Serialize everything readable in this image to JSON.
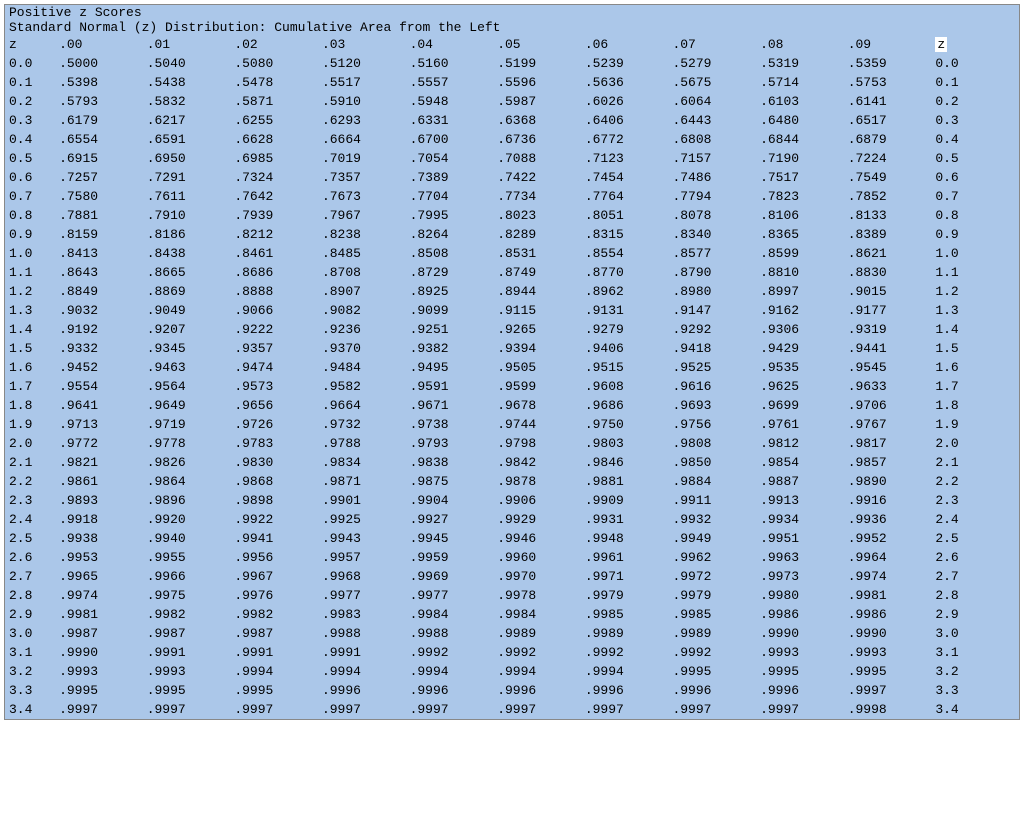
{
  "title": "Positive z Scores",
  "subtitle": "Standard Normal (z) Distribution: Cumulative Area from the Left",
  "header_z": "z",
  "col_headers": [
    ".00",
    ".01",
    ".02",
    ".03",
    ".04",
    ".05",
    ".06",
    ".07",
    ".08",
    ".09"
  ],
  "chart_data": {
    "type": "table",
    "title": "Standard Normal (z) Distribution: Cumulative Area from the Left",
    "categories": [
      "0.0",
      "0.1",
      "0.2",
      "0.3",
      "0.4",
      "0.5",
      "0.6",
      "0.7",
      "0.8",
      "0.9",
      "1.0",
      "1.1",
      "1.2",
      "1.3",
      "1.4",
      "1.5",
      "1.6",
      "1.7",
      "1.8",
      "1.9",
      "2.0",
      "2.1",
      "2.2",
      "2.3",
      "2.4",
      "2.5",
      "2.6",
      "2.7",
      "2.8",
      "2.9",
      "3.0",
      "3.1",
      "3.2",
      "3.3",
      "3.4"
    ],
    "col_labels": [
      ".00",
      ".01",
      ".02",
      ".03",
      ".04",
      ".05",
      ".06",
      ".07",
      ".08",
      ".09"
    ],
    "rows": [
      [
        ".5000",
        ".5040",
        ".5080",
        ".5120",
        ".5160",
        ".5199",
        ".5239",
        ".5279",
        ".5319",
        ".5359"
      ],
      [
        ".5398",
        ".5438",
        ".5478",
        ".5517",
        ".5557",
        ".5596",
        ".5636",
        ".5675",
        ".5714",
        ".5753"
      ],
      [
        ".5793",
        ".5832",
        ".5871",
        ".5910",
        ".5948",
        ".5987",
        ".6026",
        ".6064",
        ".6103",
        ".6141"
      ],
      [
        ".6179",
        ".6217",
        ".6255",
        ".6293",
        ".6331",
        ".6368",
        ".6406",
        ".6443",
        ".6480",
        ".6517"
      ],
      [
        ".6554",
        ".6591",
        ".6628",
        ".6664",
        ".6700",
        ".6736",
        ".6772",
        ".6808",
        ".6844",
        ".6879"
      ],
      [
        ".6915",
        ".6950",
        ".6985",
        ".7019",
        ".7054",
        ".7088",
        ".7123",
        ".7157",
        ".7190",
        ".7224"
      ],
      [
        ".7257",
        ".7291",
        ".7324",
        ".7357",
        ".7389",
        ".7422",
        ".7454",
        ".7486",
        ".7517",
        ".7549"
      ],
      [
        ".7580",
        ".7611",
        ".7642",
        ".7673",
        ".7704",
        ".7734",
        ".7764",
        ".7794",
        ".7823",
        ".7852"
      ],
      [
        ".7881",
        ".7910",
        ".7939",
        ".7967",
        ".7995",
        ".8023",
        ".8051",
        ".8078",
        ".8106",
        ".8133"
      ],
      [
        ".8159",
        ".8186",
        ".8212",
        ".8238",
        ".8264",
        ".8289",
        ".8315",
        ".8340",
        ".8365",
        ".8389"
      ],
      [
        ".8413",
        ".8438",
        ".8461",
        ".8485",
        ".8508",
        ".8531",
        ".8554",
        ".8577",
        ".8599",
        ".8621"
      ],
      [
        ".8643",
        ".8665",
        ".8686",
        ".8708",
        ".8729",
        ".8749",
        ".8770",
        ".8790",
        ".8810",
        ".8830"
      ],
      [
        ".8849",
        ".8869",
        ".8888",
        ".8907",
        ".8925",
        ".8944",
        ".8962",
        ".8980",
        ".8997",
        ".9015"
      ],
      [
        ".9032",
        ".9049",
        ".9066",
        ".9082",
        ".9099",
        ".9115",
        ".9131",
        ".9147",
        ".9162",
        ".9177"
      ],
      [
        ".9192",
        ".9207",
        ".9222",
        ".9236",
        ".9251",
        ".9265",
        ".9279",
        ".9292",
        ".9306",
        ".9319"
      ],
      [
        ".9332",
        ".9345",
        ".9357",
        ".9370",
        ".9382",
        ".9394",
        ".9406",
        ".9418",
        ".9429",
        ".9441"
      ],
      [
        ".9452",
        ".9463",
        ".9474",
        ".9484",
        ".9495",
        ".9505",
        ".9515",
        ".9525",
        ".9535",
        ".9545"
      ],
      [
        ".9554",
        ".9564",
        ".9573",
        ".9582",
        ".9591",
        ".9599",
        ".9608",
        ".9616",
        ".9625",
        ".9633"
      ],
      [
        ".9641",
        ".9649",
        ".9656",
        ".9664",
        ".9671",
        ".9678",
        ".9686",
        ".9693",
        ".9699",
        ".9706"
      ],
      [
        ".9713",
        ".9719",
        ".9726",
        ".9732",
        ".9738",
        ".9744",
        ".9750",
        ".9756",
        ".9761",
        ".9767"
      ],
      [
        ".9772",
        ".9778",
        ".9783",
        ".9788",
        ".9793",
        ".9798",
        ".9803",
        ".9808",
        ".9812",
        ".9817"
      ],
      [
        ".9821",
        ".9826",
        ".9830",
        ".9834",
        ".9838",
        ".9842",
        ".9846",
        ".9850",
        ".9854",
        ".9857"
      ],
      [
        ".9861",
        ".9864",
        ".9868",
        ".9871",
        ".9875",
        ".9878",
        ".9881",
        ".9884",
        ".9887",
        ".9890"
      ],
      [
        ".9893",
        ".9896",
        ".9898",
        ".9901",
        ".9904",
        ".9906",
        ".9909",
        ".9911",
        ".9913",
        ".9916"
      ],
      [
        ".9918",
        ".9920",
        ".9922",
        ".9925",
        ".9927",
        ".9929",
        ".9931",
        ".9932",
        ".9934",
        ".9936"
      ],
      [
        ".9938",
        ".9940",
        ".9941",
        ".9943",
        ".9945",
        ".9946",
        ".9948",
        ".9949",
        ".9951",
        ".9952"
      ],
      [
        ".9953",
        ".9955",
        ".9956",
        ".9957",
        ".9959",
        ".9960",
        ".9961",
        ".9962",
        ".9963",
        ".9964"
      ],
      [
        ".9965",
        ".9966",
        ".9967",
        ".9968",
        ".9969",
        ".9970",
        ".9971",
        ".9972",
        ".9973",
        ".9974"
      ],
      [
        ".9974",
        ".9975",
        ".9976",
        ".9977",
        ".9977",
        ".9978",
        ".9979",
        ".9979",
        ".9980",
        ".9981"
      ],
      [
        ".9981",
        ".9982",
        ".9982",
        ".9983",
        ".9984",
        ".9984",
        ".9985",
        ".9985",
        ".9986",
        ".9986"
      ],
      [
        ".9987",
        ".9987",
        ".9987",
        ".9988",
        ".9988",
        ".9989",
        ".9989",
        ".9989",
        ".9990",
        ".9990"
      ],
      [
        ".9990",
        ".9991",
        ".9991",
        ".9991",
        ".9992",
        ".9992",
        ".9992",
        ".9992",
        ".9993",
        ".9993"
      ],
      [
        ".9993",
        ".9993",
        ".9994",
        ".9994",
        ".9994",
        ".9994",
        ".9994",
        ".9995",
        ".9995",
        ".9995"
      ],
      [
        ".9995",
        ".9995",
        ".9995",
        ".9996",
        ".9996",
        ".9996",
        ".9996",
        ".9996",
        ".9996",
        ".9997"
      ],
      [
        ".9997",
        ".9997",
        ".9997",
        ".9997",
        ".9997",
        ".9997",
        ".9997",
        ".9997",
        ".9997",
        ".9998"
      ]
    ]
  }
}
